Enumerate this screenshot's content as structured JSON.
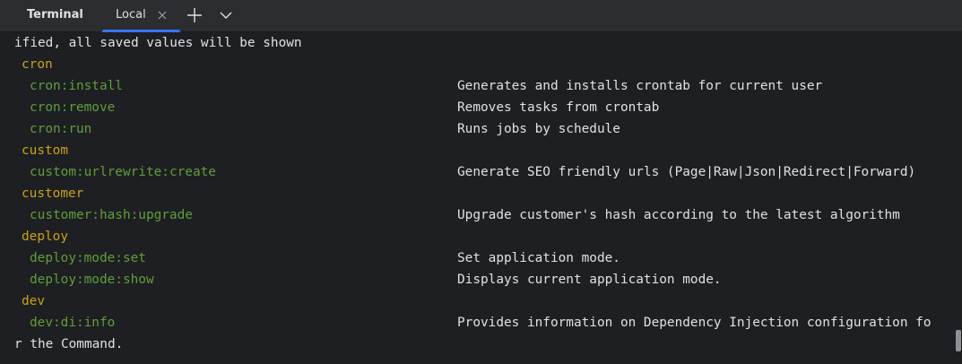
{
  "toolwindow": {
    "title": "Terminal"
  },
  "tabs": [
    {
      "label": "Local",
      "active": true
    }
  ],
  "icons": {
    "close": "close-icon",
    "add": "plus-icon",
    "menu": "chevron-down-icon"
  },
  "colors": {
    "accent": "#3574f0",
    "group": "#c9a21a",
    "command": "#5f9e3a",
    "text": "#dfe1e5",
    "background": "#1e1f22"
  },
  "terminal": {
    "top_line": "ified, all saved values will be shown",
    "groups": [
      {
        "name": "cron",
        "commands": [
          {
            "name": "cron:install",
            "description": "Generates and installs crontab for current user"
          },
          {
            "name": "cron:remove",
            "description": "Removes tasks from crontab"
          },
          {
            "name": "cron:run",
            "description": "Runs jobs by schedule"
          }
        ]
      },
      {
        "name": "custom",
        "commands": [
          {
            "name": "custom:urlrewrite:create",
            "description": "Generate SEO friendly urls (Page|Raw|Json|Redirect|Forward)"
          }
        ]
      },
      {
        "name": "customer",
        "commands": [
          {
            "name": "customer:hash:upgrade",
            "description": "Upgrade customer's hash according to the latest algorithm"
          }
        ]
      },
      {
        "name": "deploy",
        "commands": [
          {
            "name": "deploy:mode:set",
            "description": "Set application mode."
          },
          {
            "name": "deploy:mode:show",
            "description": "Displays current application mode."
          }
        ]
      },
      {
        "name": "dev",
        "commands": [
          {
            "name": "dev:di:info",
            "description": "Provides information on Dependency Injection configuration fo"
          }
        ]
      }
    ],
    "wrap_line": "r the Command."
  }
}
